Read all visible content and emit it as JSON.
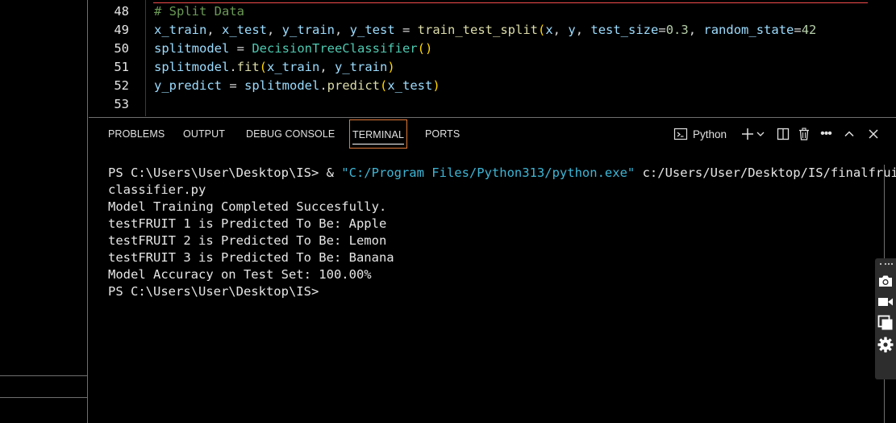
{
  "editor": {
    "lines": [
      {
        "num": "48",
        "tokens": [
          {
            "t": "# Split Data",
            "c": "cmt"
          }
        ]
      },
      {
        "num": "49",
        "tokens": [
          {
            "t": "x_train",
            "c": "var"
          },
          {
            "t": ", ",
            "c": "op"
          },
          {
            "t": "x_test",
            "c": "var"
          },
          {
            "t": ", ",
            "c": "op"
          },
          {
            "t": "y_train",
            "c": "var"
          },
          {
            "t": ", ",
            "c": "op"
          },
          {
            "t": "y_test",
            "c": "var"
          },
          {
            "t": " = ",
            "c": "op"
          },
          {
            "t": "train_test_split",
            "c": "fn"
          },
          {
            "t": "(",
            "c": "paren"
          },
          {
            "t": "x",
            "c": "var"
          },
          {
            "t": ", ",
            "c": "op"
          },
          {
            "t": "y",
            "c": "var"
          },
          {
            "t": ", ",
            "c": "op"
          },
          {
            "t": "test_size",
            "c": "var"
          },
          {
            "t": "=",
            "c": "op"
          },
          {
            "t": "0.3",
            "c": "num"
          },
          {
            "t": ", ",
            "c": "op"
          },
          {
            "t": "random_state",
            "c": "var"
          },
          {
            "t": "=",
            "c": "op"
          },
          {
            "t": "42",
            "c": "num"
          }
        ]
      },
      {
        "num": "50",
        "tokens": [
          {
            "t": "splitmodel",
            "c": "var"
          },
          {
            "t": " = ",
            "c": "op"
          },
          {
            "t": "DecisionTreeClassifier",
            "c": "cls"
          },
          {
            "t": "()",
            "c": "paren"
          }
        ]
      },
      {
        "num": "51",
        "tokens": [
          {
            "t": "splitmodel",
            "c": "var"
          },
          {
            "t": ".",
            "c": "op"
          },
          {
            "t": "fit",
            "c": "fn"
          },
          {
            "t": "(",
            "c": "paren"
          },
          {
            "t": "x_train",
            "c": "var"
          },
          {
            "t": ", ",
            "c": "op"
          },
          {
            "t": "y_train",
            "c": "var"
          },
          {
            "t": ")",
            "c": "paren"
          }
        ]
      },
      {
        "num": "52",
        "tokens": [
          {
            "t": "y_predict",
            "c": "var"
          },
          {
            "t": " = ",
            "c": "op"
          },
          {
            "t": "splitmodel",
            "c": "var"
          },
          {
            "t": ".",
            "c": "op"
          },
          {
            "t": "predict",
            "c": "fn"
          },
          {
            "t": "(",
            "c": "paren"
          },
          {
            "t": "x_test",
            "c": "var"
          },
          {
            "t": ")",
            "c": "paren"
          }
        ]
      },
      {
        "num": "53",
        "tokens": []
      }
    ]
  },
  "panel": {
    "tabs": [
      "PROBLEMS",
      "OUTPUT",
      "DEBUG CONSOLE",
      "TERMINAL",
      "PORTS"
    ],
    "active_tab": "TERMINAL",
    "shell_label": "Python",
    "shell_icon": "terminal-icon",
    "add_icon": "plus-icon",
    "dropdown_icon": "chevron-down-icon",
    "split_icon": "split-terminal-icon",
    "trash_icon": "trash-icon",
    "more_icon": "ellipsis-icon",
    "maximize_icon": "chevron-up-icon",
    "close_icon": "close-icon"
  },
  "terminal": {
    "prompt1": "PS C:\\Users\\User\\Desktop\\IS> ",
    "amp": "& ",
    "exe_path": "\"C:/Program Files/Python313/python.exe\"",
    "script_path_1": " c:/Users/User/Desktop/IS/finalfruit",
    "script_path_2": "classifier.py",
    "output": [
      "Model Training Completed Succesfully.",
      "testFRUIT 1 is Predicted To Be: Apple",
      "testFRUIT 2 is Predicted To Be: Lemon",
      "testFRUIT 3 is Predicted To Be: Banana",
      "Model Accuracy on Test Set: 100.00%"
    ],
    "prompt2": "PS C:\\Users\\User\\Desktop\\IS>"
  },
  "floating_toolbar": {
    "icons": [
      "drag-handle-icon",
      "camera-icon",
      "video-icon",
      "copy-windows-icon",
      "gear-icon"
    ]
  },
  "colors": {
    "accent_tab_border": "#e07a3a",
    "string": "#3eb6d6",
    "error_line": "#f14c4c"
  }
}
